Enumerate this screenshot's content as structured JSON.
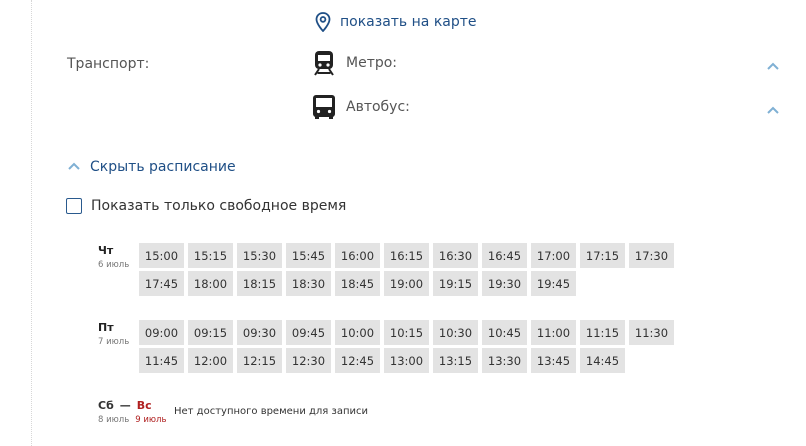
{
  "map_link": {
    "label": "показать на карте",
    "icon": "map-pin-icon"
  },
  "transport": {
    "label": "Транспорт:",
    "items": [
      {
        "label": "Метро:",
        "icon": "metro-train-icon"
      },
      {
        "label": "Автобус:",
        "icon": "bus-icon"
      }
    ]
  },
  "schedule_toggle": {
    "label": "Скрыть расписание",
    "icon": "chevron-up-icon"
  },
  "free_only": {
    "label": "Показать только свободное время",
    "checked": false
  },
  "days": [
    {
      "name": "Чт",
      "date": "6 июль",
      "slots": [
        "15:00",
        "15:15",
        "15:30",
        "15:45",
        "16:00",
        "16:15",
        "16:30",
        "16:45",
        "17:00",
        "17:15",
        "17:30",
        "17:45",
        "18:00",
        "18:15",
        "18:30",
        "18:45",
        "19:00",
        "19:15",
        "19:30",
        "19:45"
      ]
    },
    {
      "name": "Пт",
      "date": "7 июль",
      "slots": [
        "09:00",
        "09:15",
        "09:30",
        "09:45",
        "10:00",
        "10:15",
        "10:30",
        "10:45",
        "11:00",
        "11:15",
        "11:30",
        "11:45",
        "12:00",
        "12:15",
        "12:30",
        "12:45",
        "13:00",
        "13:15",
        "13:30",
        "13:45",
        "14:45"
      ]
    }
  ],
  "weekend": {
    "sat_name": "Сб",
    "dash": "—",
    "sun_name": "Вс",
    "sat_date": "8 июль",
    "sun_date": "9 июль",
    "message": "Нет доступного времени для записи"
  },
  "colors": {
    "link": "#1f4f86",
    "slot_bg": "#e3e3e3",
    "sunday": "#b02020",
    "chevron": "#7fb0d4"
  }
}
